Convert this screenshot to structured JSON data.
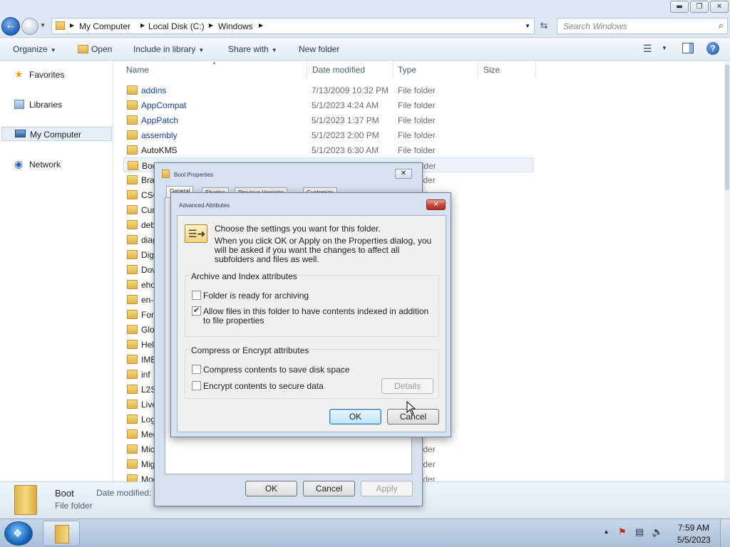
{
  "window": {
    "caption_buttons": {
      "minimize": "▬",
      "maximize": "❐",
      "close": "✕"
    }
  },
  "address": {
    "crumbs": [
      "My Computer",
      "Local Disk (C:)",
      "Windows"
    ],
    "search_placeholder": "Search Windows"
  },
  "toolbar": {
    "organize": "Organize",
    "open": "Open",
    "include": "Include in library",
    "share": "Share with",
    "new_folder": "New folder"
  },
  "nav": {
    "favorites": "Favorites",
    "libraries": "Libraries",
    "computer": "My Computer",
    "network": "Network"
  },
  "columns": {
    "name": "Name",
    "date": "Date modified",
    "type": "Type",
    "size": "Size"
  },
  "files": [
    {
      "name": "addins",
      "date": "7/13/2009 10:32 PM",
      "type": "File folder",
      "sys": true
    },
    {
      "name": "AppCompat",
      "date": "5/1/2023 4:24 AM",
      "type": "File folder",
      "sys": true
    },
    {
      "name": "AppPatch",
      "date": "5/1/2023 1:37 PM",
      "type": "File folder",
      "sys": true
    },
    {
      "name": "assembly",
      "date": "5/1/2023 2:00 PM",
      "type": "File folder",
      "sys": true
    },
    {
      "name": "AutoKMS",
      "date": "5/1/2023 6:30 AM",
      "type": "File folder",
      "sys": false
    },
    {
      "name": "Boot",
      "date": "",
      "type": "File folder",
      "sys": false,
      "selected": true
    },
    {
      "name": "Branding",
      "date": "",
      "type": "File folder",
      "sys": false
    },
    {
      "name": "CSC",
      "date": "",
      "type": "File folder",
      "sys": false
    },
    {
      "name": "Cursors",
      "date": "",
      "type": "File folder",
      "sys": false
    },
    {
      "name": "debug",
      "date": "",
      "type": "File folder",
      "sys": false
    },
    {
      "name": "diagnostics",
      "date": "",
      "type": "File folder",
      "sys": false
    },
    {
      "name": "DigitalLocker",
      "date": "",
      "type": "File folder",
      "sys": false
    },
    {
      "name": "Downloaded Program Files",
      "date": "",
      "type": "File folder",
      "sys": false
    },
    {
      "name": "ehome",
      "date": "",
      "type": "File folder",
      "sys": false
    },
    {
      "name": "en-US",
      "date": "",
      "type": "File folder",
      "sys": false
    },
    {
      "name": "Fonts",
      "date": "",
      "type": "File folder",
      "sys": false
    },
    {
      "name": "Globalization",
      "date": "",
      "type": "File folder",
      "sys": false
    },
    {
      "name": "Help",
      "date": "",
      "type": "File folder",
      "sys": false
    },
    {
      "name": "IME",
      "date": "",
      "type": "File folder",
      "sys": false
    },
    {
      "name": "inf",
      "date": "",
      "type": "File folder",
      "sys": false
    },
    {
      "name": "L2Schemas",
      "date": "",
      "type": "File folder",
      "sys": false
    },
    {
      "name": "LiveKernelReports",
      "date": "",
      "type": "File folder",
      "sys": false
    },
    {
      "name": "Logs",
      "date": "",
      "type": "File folder",
      "sys": false
    },
    {
      "name": "Media",
      "date": "",
      "type": "File folder",
      "sys": false
    },
    {
      "name": "Microsoft.NET",
      "date": "",
      "type": "File folder",
      "sys": false
    },
    {
      "name": "Migration",
      "date": "",
      "type": "File folder",
      "sys": false
    },
    {
      "name": "Modules",
      "date": "",
      "type": "File folder",
      "sys": false
    }
  ],
  "visible_types": {
    "boot": "older",
    "r25": "older",
    "r26": "older",
    "r27": "older"
  },
  "details": {
    "name": "Boot",
    "type": "File folder",
    "modified_label": "Date modified:"
  },
  "taskbar": {
    "time": "7:59 AM",
    "date": "5/5/2023"
  },
  "props": {
    "title": "Boot Properties",
    "tabs": [
      "General",
      "Sharing",
      "Previous Versions",
      "Customize"
    ],
    "ok": "OK",
    "cancel": "Cancel",
    "apply": "Apply"
  },
  "adv": {
    "title": "Advanced Attributes",
    "intro": "Choose the settings you want for this folder.",
    "desc": "When you click OK or Apply on the Properties dialog, you will be asked if you want the changes to affect all subfolders and files as well.",
    "archive_group": "Archive and Index attributes",
    "archive_label": "Folder is ready for archiving",
    "archive_checked": false,
    "index_label": "Allow files in this folder to have contents indexed in addition to file properties",
    "index_checked": true,
    "compress_group": "Compress or Encrypt attributes",
    "compress_label": "Compress contents to save disk space",
    "compress_checked": false,
    "encrypt_label": "Encrypt contents to secure data",
    "encrypt_checked": false,
    "details_btn": "Details",
    "ok": "OK",
    "cancel": "Cancel"
  }
}
